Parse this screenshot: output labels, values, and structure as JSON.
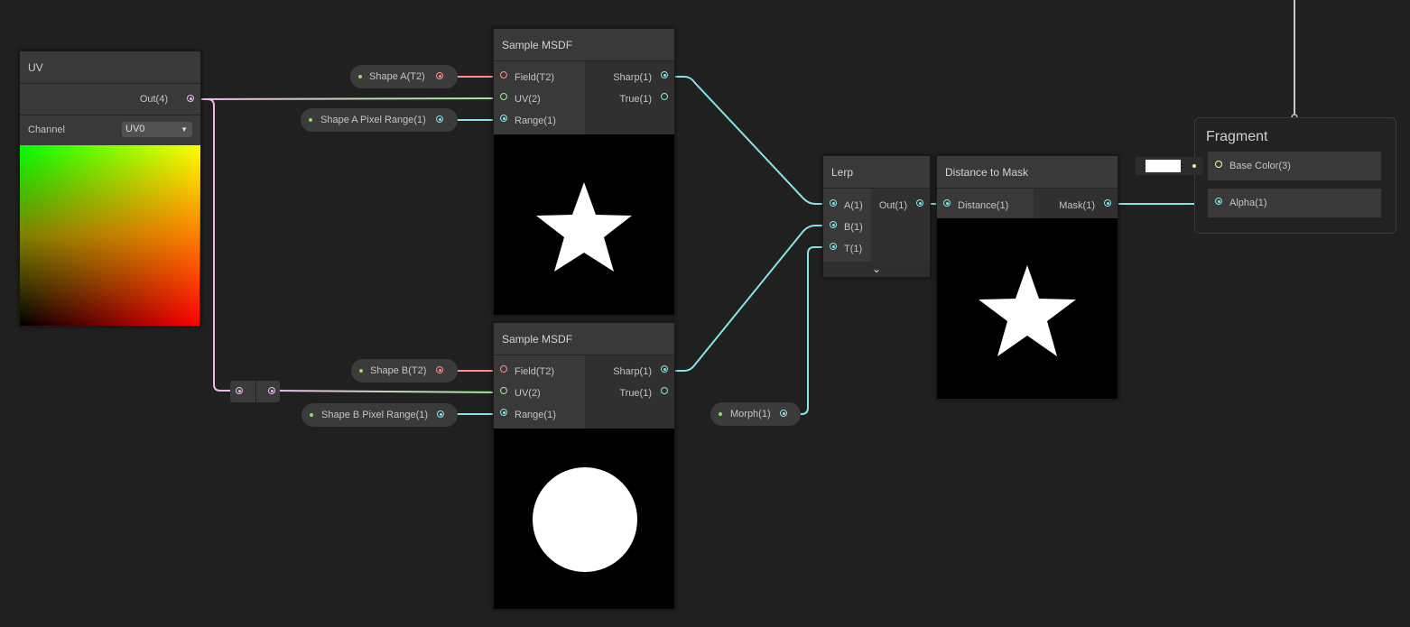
{
  "colors": {
    "background": "#202020",
    "uv": "#f0b8e8",
    "float": "#84e4e7",
    "texture": "#ff8b8b",
    "vector2": "#9aef92",
    "vector3": "#f6ff9a"
  },
  "uv_node": {
    "title": "UV",
    "output": "Out(4)",
    "channel_label": "Channel",
    "channel_value": "UV0"
  },
  "sample_a": {
    "title": "Sample MSDF",
    "inputs": [
      "Field(T2)",
      "UV(2)",
      "Range(1)"
    ],
    "outputs": [
      "Sharp(1)",
      "True(1)"
    ],
    "preview_shape": "star"
  },
  "sample_b": {
    "title": "Sample MSDF",
    "inputs": [
      "Field(T2)",
      "UV(2)",
      "Range(1)"
    ],
    "outputs": [
      "Sharp(1)",
      "True(1)"
    ],
    "preview_shape": "circle"
  },
  "properties": {
    "shape_a": "Shape A(T2)",
    "shape_a_range": "Shape A Pixel Range(1)",
    "shape_b": "Shape B(T2)",
    "shape_b_range": "Shape B Pixel Range(1)",
    "morph": "Morph(1)"
  },
  "lerp": {
    "title": "Lerp",
    "inputs": [
      "A(1)",
      "B(1)",
      "T(1)"
    ],
    "output": "Out(1)"
  },
  "distance_to_mask": {
    "title": "Distance to Mask",
    "input": "Distance(1)",
    "output": "Mask(1)",
    "preview_shape": "star"
  },
  "fragment": {
    "title": "Fragment",
    "slots": [
      "Base Color(3)",
      "Alpha(1)"
    ],
    "base_color_value": "#ffffff"
  }
}
